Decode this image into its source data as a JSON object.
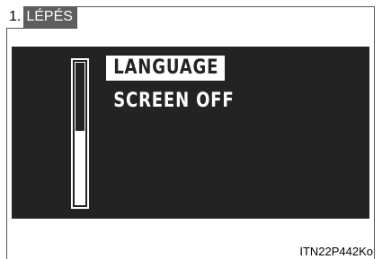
{
  "step": {
    "number": "1.",
    "word": "LÉPÉS"
  },
  "menu": {
    "items": [
      {
        "label": "LANGUAGE",
        "selected": true
      },
      {
        "label": "SCREEN OFF",
        "selected": false
      }
    ],
    "scroll_position_fraction": 0.52
  },
  "image_code": "ITN22P442Ko",
  "colors": {
    "screen_background": "#232323",
    "step_word_background": "#5e5e5e",
    "highlight": "#ffffff"
  }
}
